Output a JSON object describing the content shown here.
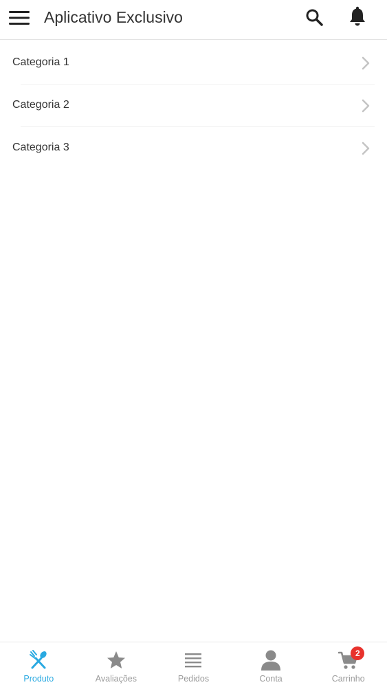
{
  "header": {
    "title": "Aplicativo Exclusivo",
    "menu_icon": "hamburger-menu-icon",
    "search_icon": "search-icon",
    "notification_icon": "bell-icon"
  },
  "categories": [
    {
      "label": "Categoria 1"
    },
    {
      "label": "Categoria 2"
    },
    {
      "label": "Categoria 3"
    }
  ],
  "tabbar": {
    "active_color": "#29a9e1",
    "inactive_color": "#9a9a9a",
    "tabs": [
      {
        "label": "Produto",
        "icon": "utensils-icon",
        "active": true
      },
      {
        "label": "Avaliações",
        "icon": "star-icon"
      },
      {
        "label": "Pedidos",
        "icon": "list-icon"
      },
      {
        "label": "Conta",
        "icon": "user-icon"
      },
      {
        "label": "Carrinho",
        "icon": "cart-icon",
        "badge": "2"
      }
    ]
  }
}
